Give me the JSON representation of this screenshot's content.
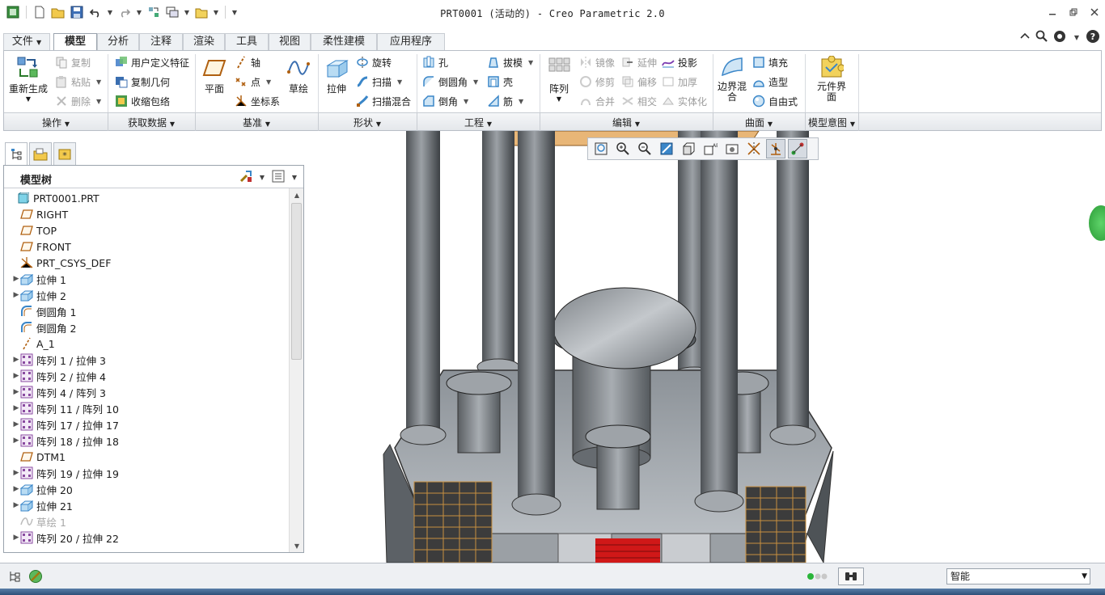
{
  "window": {
    "title": "PRT0001 (活动的) - Creo Parametric 2.0"
  },
  "ribbon_tabs": [
    "文件",
    "模型",
    "分析",
    "注释",
    "渲染",
    "工具",
    "视图",
    "柔性建模",
    "应用程序"
  ],
  "ribbon_groups": {
    "operations": {
      "label": "操作",
      "regenerate": "重新生成",
      "copy": "复制",
      "paste": "粘贴",
      "delete": "删除"
    },
    "get_data": {
      "label": "获取数据",
      "udf": "用户定义特征",
      "copy_geom": "复制几何",
      "shrinkwrap": "收缩包络"
    },
    "datum": {
      "label": "基准",
      "plane": "平面",
      "axis": "轴",
      "point": "点",
      "csys": "坐标系",
      "sketch": "草绘"
    },
    "shapes": {
      "label": "形状",
      "extrude": "拉伸",
      "revolve": "旋转",
      "sweep": "扫描",
      "swept_blend": "扫描混合"
    },
    "engineering": {
      "label": "工程",
      "hole": "孔",
      "round": "倒圆角",
      "chamfer": "倒角",
      "draft": "拔模",
      "shell": "壳",
      "rib": "筋"
    },
    "editing": {
      "label": "编辑",
      "pattern": "阵列",
      "mirror": "镜像",
      "trim": "修剪",
      "merge": "合并",
      "extend": "延伸",
      "offset": "偏移",
      "intersect": "相交",
      "project": "投影",
      "thicken": "加厚",
      "solidify": "实体化"
    },
    "surfaces": {
      "label": "曲面",
      "boundary_blend": "边界混合",
      "fill": "填充",
      "style": "造型",
      "freestyle": "自由式"
    },
    "design_intent": {
      "label": "模型意图",
      "component_interface": "元件界面"
    }
  },
  "model_tree": {
    "title": "模型树",
    "items": [
      {
        "label": "PRT0001.PRT",
        "icon": "part-icon",
        "expand": false,
        "indent": 0
      },
      {
        "label": "RIGHT",
        "icon": "datum-plane-icon",
        "expand": false,
        "indent": 1
      },
      {
        "label": "TOP",
        "icon": "datum-plane-icon",
        "expand": false,
        "indent": 1
      },
      {
        "label": "FRONT",
        "icon": "datum-plane-icon",
        "expand": false,
        "indent": 1
      },
      {
        "label": "PRT_CSYS_DEF",
        "icon": "csys-icon",
        "expand": false,
        "indent": 1
      },
      {
        "label": "拉伸 1",
        "icon": "extrude-icon",
        "expand": true,
        "indent": 1
      },
      {
        "label": "拉伸 2",
        "icon": "extrude-icon",
        "expand": true,
        "indent": 1
      },
      {
        "label": "倒圆角 1",
        "icon": "round-icon",
        "expand": false,
        "indent": 1
      },
      {
        "label": "倒圆角 2",
        "icon": "round-icon",
        "expand": false,
        "indent": 1
      },
      {
        "label": "A_1",
        "icon": "datum-axis-icon",
        "expand": false,
        "indent": 1
      },
      {
        "label": "阵列 1 / 拉伸 3",
        "icon": "pattern-icon",
        "expand": true,
        "indent": 1
      },
      {
        "label": "阵列 2 / 拉伸 4",
        "icon": "pattern-icon",
        "expand": true,
        "indent": 1
      },
      {
        "label": "阵列 4 / 阵列 3",
        "icon": "pattern-icon",
        "expand": true,
        "indent": 1
      },
      {
        "label": "阵列 11 / 阵列 10",
        "icon": "pattern-icon",
        "expand": true,
        "indent": 1
      },
      {
        "label": "阵列 17 / 拉伸 17",
        "icon": "pattern-icon",
        "expand": true,
        "indent": 1
      },
      {
        "label": "阵列 18 / 拉伸 18",
        "icon": "pattern-icon",
        "expand": true,
        "indent": 1
      },
      {
        "label": "DTM1",
        "icon": "datum-plane-icon",
        "expand": false,
        "indent": 1
      },
      {
        "label": "阵列 19 / 拉伸 19",
        "icon": "pattern-icon",
        "expand": true,
        "indent": 1
      },
      {
        "label": "拉伸 20",
        "icon": "extrude-icon",
        "expand": true,
        "indent": 1
      },
      {
        "label": "拉伸 21",
        "icon": "extrude-icon",
        "expand": true,
        "indent": 1
      },
      {
        "label": "草绘 1",
        "icon": "sketch-icon",
        "expand": false,
        "indent": 1,
        "disabled": true
      },
      {
        "label": "阵列 20 / 拉伸 22",
        "icon": "pattern-icon",
        "expand": true,
        "indent": 1
      }
    ]
  },
  "status": {
    "filter": "智能"
  },
  "colors": {
    "pillar": "#6f7377",
    "accent_red": "#d01818",
    "ribbon_border": "#b8bec6"
  }
}
